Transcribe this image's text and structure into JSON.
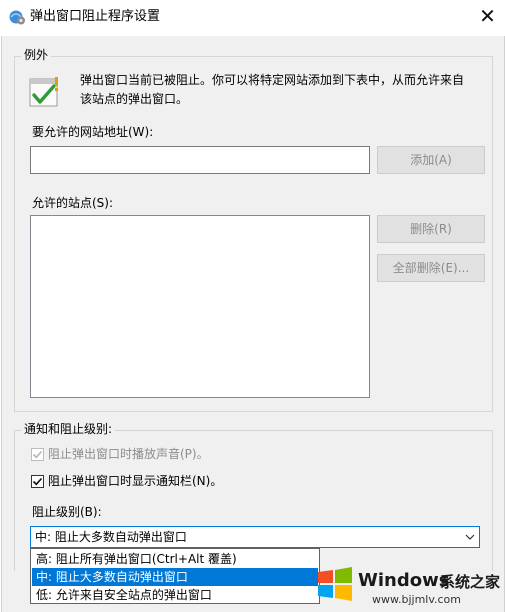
{
  "window": {
    "title": "弹出窗口阻止程序设置",
    "close_glyph": "✕"
  },
  "exceptions": {
    "legend": "例外",
    "info_line1": "弹出窗口当前已被阻止。你可以将特定网站添加到下表中，从而允许来自",
    "info_line2": "该站点的弹出窗口。",
    "address_label": "要允许的网站地址(W):",
    "address_value": "",
    "add_button": "添加(A)",
    "allowed_label": "允许的站点(S):",
    "allowed_sites": [],
    "remove_button": "删除(R)",
    "remove_all_button": "全部删除(E)..."
  },
  "notify": {
    "legend": "通知和阻止级别:",
    "play_sound_label": "阻止弹出窗口时播放声音(P)。",
    "play_sound_checked": true,
    "show_bar_label": "阻止弹出窗口时显示通知栏(N)。",
    "show_bar_checked": true,
    "level_label": "阻止级别(B):",
    "level_selected": "中: 阻止大多数自动弹出窗口",
    "level_options": [
      "高: 阻止所有弹出窗口(Ctrl+Alt 覆盖)",
      "中: 阻止大多数自动弹出窗口",
      "低: 允许来自安全站点的弹出窗口"
    ],
    "level_selected_index": 1
  },
  "watermark": {
    "brand": "Windows",
    "brand_suffix": "系统之家",
    "url": "www.bjjmlv.com"
  },
  "colors": {
    "accent": "#0078d7",
    "disabled_text": "#8c8c8c",
    "dialog_bg": "#f0f0f0",
    "check_green": "#2e9a38"
  },
  "icons": {
    "title": "ie-settings-icon",
    "info": "popup-blocker-icon",
    "close": "close-icon",
    "dropdown": "chevron-down-icon"
  }
}
